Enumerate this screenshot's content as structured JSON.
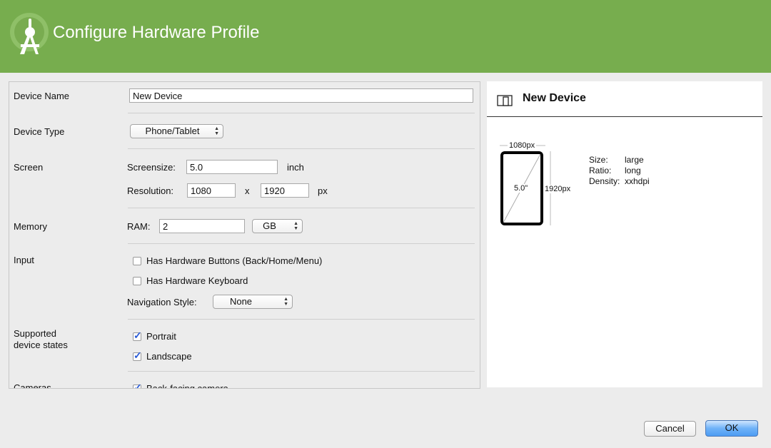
{
  "header": {
    "title": "Configure Hardware Profile"
  },
  "form": {
    "device_name": {
      "label": "Device Name",
      "value": "New Device"
    },
    "device_type": {
      "label": "Device Type",
      "value": "Phone/Tablet"
    },
    "screen": {
      "label": "Screen",
      "screensize_label": "Screensize:",
      "screensize_value": "5.0",
      "screensize_unit": "inch",
      "resolution_label": "Resolution:",
      "res_width": "1080",
      "res_sep": "x",
      "res_height": "1920",
      "res_unit": "px"
    },
    "memory": {
      "label": "Memory",
      "ram_label": "RAM:",
      "ram_value": "2",
      "ram_unit": "GB"
    },
    "input": {
      "label": "Input",
      "hw_buttons_label": "Has Hardware Buttons (Back/Home/Menu)",
      "hw_buttons_checked": false,
      "hw_keyboard_label": "Has Hardware Keyboard",
      "hw_keyboard_checked": false,
      "nav_style_label": "Navigation Style:",
      "nav_style_value": "None"
    },
    "device_states": {
      "label_line1": "Supported",
      "label_line2": "device states",
      "portrait_label": "Portrait",
      "portrait_checked": true,
      "landscape_label": "Landscape",
      "landscape_checked": true
    },
    "cameras": {
      "label": "Cameras",
      "back_label": "Back-facing camera",
      "back_checked": true
    }
  },
  "preview": {
    "title": "New Device",
    "width_label": "1080px",
    "height_label": "1920px",
    "diagonal_label": "5.0\"",
    "size_key": "Size:",
    "size_value": "large",
    "ratio_key": "Ratio:",
    "ratio_value": "long",
    "density_key": "Density:",
    "density_value": "xxhdpi"
  },
  "buttons": {
    "cancel": "Cancel",
    "ok": "OK"
  },
  "colors": {
    "header_bg": "#77ad4e",
    "ok_button": "#6fb2f8",
    "checkmark": "#2a5bd7"
  }
}
